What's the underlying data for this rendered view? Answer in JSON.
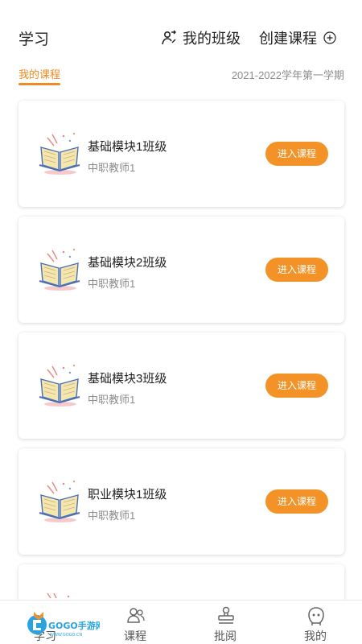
{
  "header": {
    "title": "学习",
    "my_class_label": "我的班级",
    "create_course_label": "创建课程"
  },
  "subbar": {
    "tab_label": "我的课程",
    "term": "2021-2022学年第一学期"
  },
  "courses": [
    {
      "title": "基础模块1班级",
      "teacher": "中职教师1",
      "button": "进入课程"
    },
    {
      "title": "基础模块2班级",
      "teacher": "中职教师1",
      "button": "进入课程"
    },
    {
      "title": "基础模块3班级",
      "teacher": "中职教师1",
      "button": "进入课程"
    },
    {
      "title": "职业模块1班级",
      "teacher": "中职教师1",
      "button": "进入课程"
    }
  ],
  "tabbar": {
    "items": [
      {
        "label": "学习"
      },
      {
        "label": "课程"
      },
      {
        "label": "批阅"
      },
      {
        "label": "我的"
      }
    ]
  },
  "watermark": {
    "text": "GOGO手游网",
    "url_text": "WWW.GOGO.CN"
  },
  "colors": {
    "accent": "#f39227",
    "tab_active": "#f08a24",
    "muted": "#8c8c8c"
  }
}
